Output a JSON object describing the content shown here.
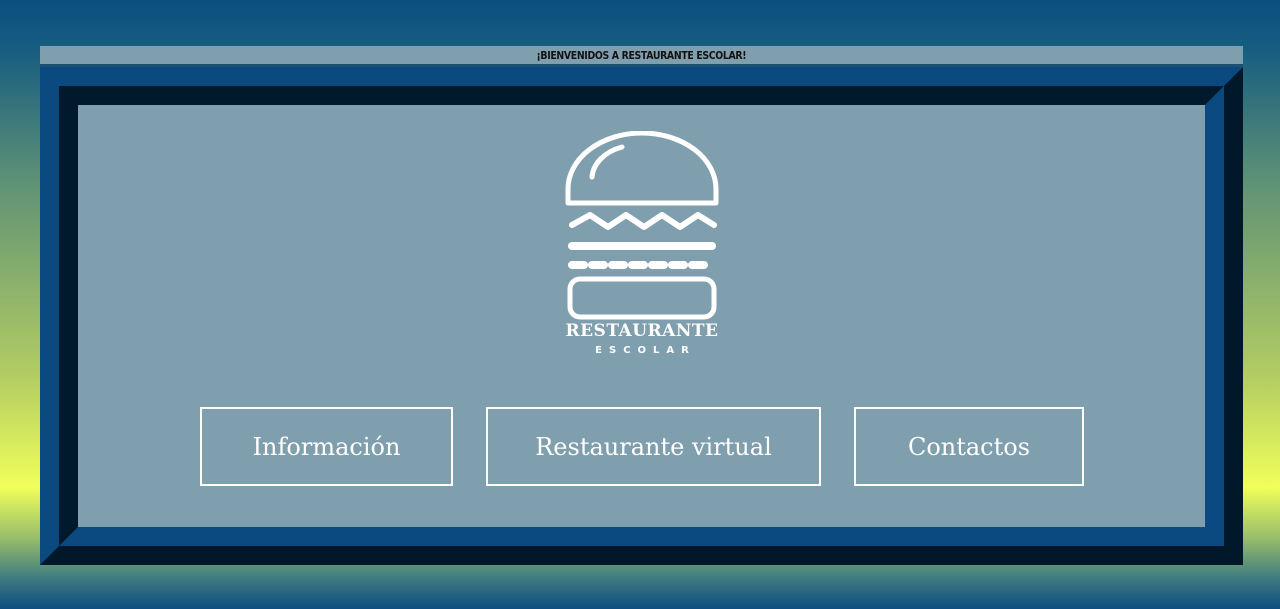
{
  "banner": {
    "text": "¡BIENVENIDOS A RESTAURANTE ESCOLAR!"
  },
  "logo": {
    "icon": "burger-icon",
    "title": "RESTAURANTE",
    "subtitle": "ESCOLAR"
  },
  "nav": {
    "buttons": [
      {
        "label": "Información"
      },
      {
        "label": "Restaurante virtual"
      },
      {
        "label": "Contactos"
      }
    ]
  },
  "colors": {
    "panel": "#7f9fae",
    "frame_light": "#0a4a80",
    "frame_dark": "#00182a",
    "text": "#ffffff"
  }
}
